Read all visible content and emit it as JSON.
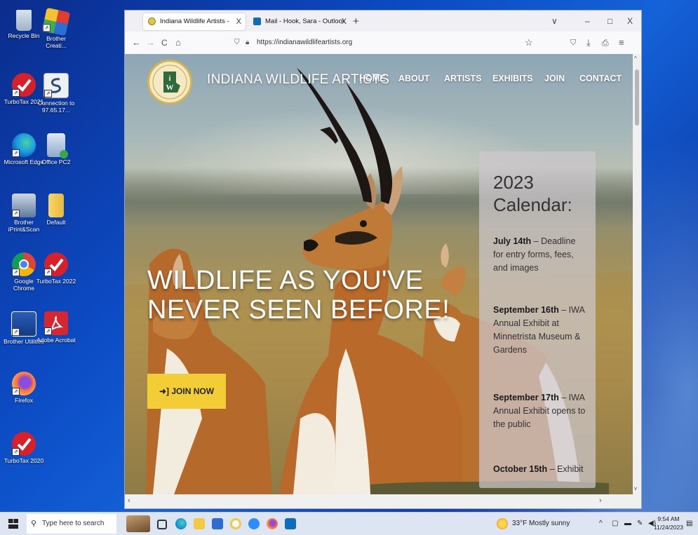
{
  "desktop": {
    "icons": [
      {
        "label": "Recycle Bin",
        "icon": "recycle-bin-icon"
      },
      {
        "label": "Brother Creati...",
        "icon": "brother-creative-icon"
      },
      {
        "label": "TurboTax 2021",
        "icon": "turbotax-icon"
      },
      {
        "label": "Connection to 97.65.17...",
        "icon": "remote-connection-icon"
      },
      {
        "label": "Microsoft Edge",
        "icon": "edge-icon"
      },
      {
        "label": "Office PC2",
        "icon": "office-pc-icon"
      },
      {
        "label": "Brother iPrint&Scan",
        "icon": "brother-iprint-icon"
      },
      {
        "label": "Default",
        "icon": "folder-icon"
      },
      {
        "label": "Google Chrome",
        "icon": "chrome-icon"
      },
      {
        "label": "TurboTax 2022",
        "icon": "turbotax-icon"
      },
      {
        "label": "Brother Utilities",
        "icon": "brother-utilities-icon"
      },
      {
        "label": "Adobe Acrobat",
        "icon": "acrobat-icon"
      },
      {
        "label": "Firefox",
        "icon": "firefox-icon"
      },
      {
        "label": "TurboTax 2020",
        "icon": "turbotax-icon"
      }
    ]
  },
  "browser": {
    "tabs": [
      {
        "title": "Indiana Wildlife Artists - Appre",
        "close": "X"
      },
      {
        "title": "Mail - Hook, Sara - Outlook",
        "close": "X"
      }
    ],
    "new_tab": "+",
    "window_controls": {
      "menu": "∨",
      "minimize": "–",
      "maximize": "□",
      "close": "X"
    },
    "url": "https://indianawildlifeartists.org",
    "nav": {
      "back": "←",
      "forward": "→",
      "reload": "C",
      "home": "⌂"
    }
  },
  "site": {
    "title": "INDIANA WILDLIFE ARTISTS",
    "nav": [
      "HOME",
      "ABOUT",
      "ARTISTS",
      "EXHIBITS",
      "JOIN",
      "CONTACT"
    ],
    "headline_line1": "WILDLIFE AS YOU'VE",
    "headline_line2": "NEVER SEEN BEFORE!",
    "join_button": "➜] JOIN NOW",
    "calendar": {
      "title_line1": "2023",
      "title_line2": "Calendar:",
      "items": [
        {
          "date": "July 14th",
          "text": " – Deadline for entry forms, fees, and images"
        },
        {
          "date": "September 16th",
          "text": " – IWA Annual Exhibit at Minnetrista Museum & Gardens"
        },
        {
          "date": "September 17th",
          "text": " – IWA Annual Exhibit opens to the public"
        },
        {
          "date": "October 15th",
          "text": " – Exhibit"
        }
      ]
    }
  },
  "taskbar": {
    "search_placeholder": "Type here to search",
    "weather": "33°F  Mostly sunny",
    "time": "9:54 AM",
    "date": "11/24/2023"
  },
  "colors": {
    "join_button": "#f2cd36",
    "desktop_blue": "#0c4bc4"
  }
}
